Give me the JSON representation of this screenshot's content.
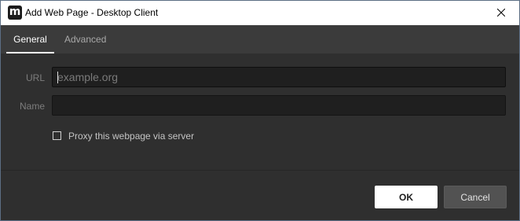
{
  "window": {
    "title": "Add Web Page - Desktop Client",
    "app_icon_letter": "m"
  },
  "tabs": [
    {
      "label": "General",
      "active": true
    },
    {
      "label": "Advanced",
      "active": false
    }
  ],
  "form": {
    "url": {
      "label": "URL",
      "value": "",
      "placeholder": "example.org"
    },
    "name": {
      "label": "Name",
      "value": "",
      "placeholder": ""
    },
    "proxy": {
      "label": "Proxy this webpage via server",
      "checked": false
    }
  },
  "buttons": {
    "ok": "OK",
    "cancel": "Cancel"
  },
  "colors": {
    "accent_active_tab": "#ffffff",
    "background": "#2f2f2f",
    "input_background": "#1f1f1f"
  },
  "icons": {
    "app": "app-logo-icon",
    "close": "close-icon"
  }
}
